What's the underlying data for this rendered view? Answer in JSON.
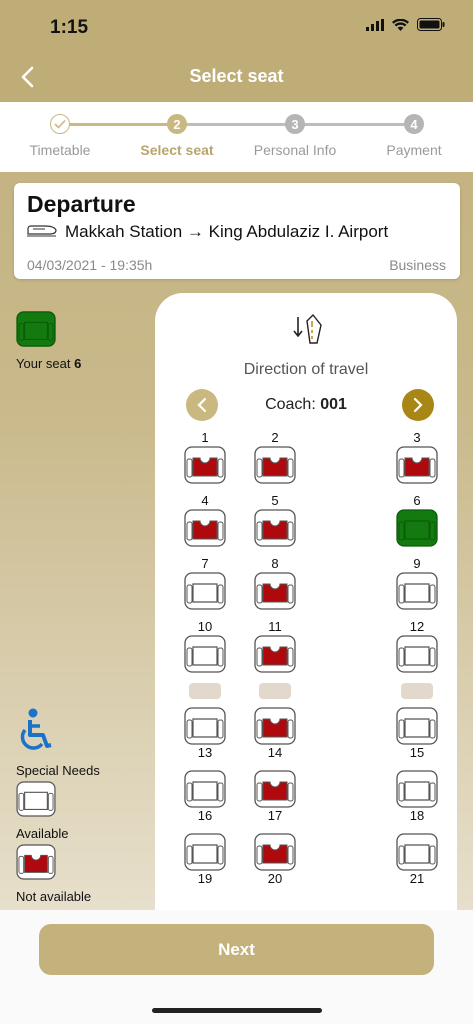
{
  "status": {
    "time": "1:15"
  },
  "header": {
    "title": "Select seat"
  },
  "stepper": {
    "steps": [
      {
        "number": "✓",
        "label": "Timetable",
        "state": "done"
      },
      {
        "number": "2",
        "label": "Select seat",
        "state": "active"
      },
      {
        "number": "3",
        "label": "Personal Info",
        "state": "pending"
      },
      {
        "number": "4",
        "label": "Payment",
        "state": "pending"
      }
    ]
  },
  "trip": {
    "title": "Departure",
    "route": "Makkah Station → King Abdulaziz I. Airport",
    "datetime": "04/03/2021 - 19:35h",
    "class": "Business"
  },
  "legend": {
    "your_seat_label": "Your seat",
    "your_seat_number": "6",
    "special_needs": "Special Needs",
    "available": "Available",
    "not_available": "Not available"
  },
  "seatmap": {
    "direction_label": "Direction of travel",
    "coach_label": "Coach:",
    "coach_number": "001",
    "seats": [
      {
        "n": "1",
        "status": "taken"
      },
      {
        "n": "2",
        "status": "taken"
      },
      {
        "n": "3",
        "status": "taken"
      },
      {
        "n": "4",
        "status": "taken"
      },
      {
        "n": "5",
        "status": "taken"
      },
      {
        "n": "6",
        "status": "selected"
      },
      {
        "n": "7",
        "status": "available"
      },
      {
        "n": "8",
        "status": "taken"
      },
      {
        "n": "9",
        "status": "available"
      },
      {
        "n": "10",
        "status": "available"
      },
      {
        "n": "11",
        "status": "taken"
      },
      {
        "n": "12",
        "status": "available"
      },
      {
        "n": "13",
        "status": "available"
      },
      {
        "n": "14",
        "status": "taken"
      },
      {
        "n": "15",
        "status": "available"
      },
      {
        "n": "16",
        "status": "available"
      },
      {
        "n": "17",
        "status": "taken"
      },
      {
        "n": "18",
        "status": "available"
      },
      {
        "n": "19",
        "status": "available"
      },
      {
        "n": "20",
        "status": "taken"
      },
      {
        "n": "21",
        "status": "available"
      }
    ]
  },
  "colors": {
    "gold": "#bfad78",
    "taken": "#b0090d",
    "selected": "#137a10",
    "special_needs": "#1a73c8"
  },
  "footer": {
    "next_label": "Next"
  }
}
